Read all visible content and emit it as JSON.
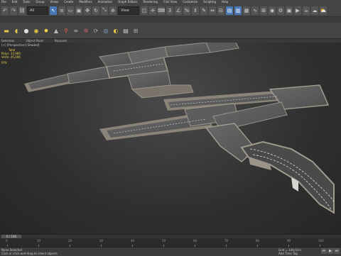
{
  "menu": [
    "File",
    "Edit",
    "Tools",
    "Group",
    "Views",
    "Create",
    "Modifiers",
    "Animation",
    "Graph Editors",
    "Rendering",
    "Civil View",
    "Customize",
    "Scripting",
    "Help"
  ],
  "toolbar": {
    "undo_icon": "↶",
    "redo_icon": "↷",
    "link_icon": "⛓",
    "filter_value": "All",
    "select_icon": "↖",
    "view_dropdown": "View",
    "render_icon": "▶"
  },
  "ribbon_icons": [
    "box-icon",
    "sphere-icon",
    "cylinder-icon",
    "light-icon",
    "camera-icon",
    "helper-icon",
    "space-warp-icon",
    "system-icon",
    "modifier-icon",
    "display-icon",
    "utility-icon",
    "shape-icon",
    "material-icon"
  ],
  "tabs": [
    "Selection",
    "Object Paint",
    "Populate"
  ],
  "viewport": {
    "label": "[+] [Perspective] [Shaded]",
    "stats_header": "Total",
    "polys_label": "Polys:",
    "polys_value": "32,960",
    "verts_label": "Verts:",
    "verts_value": "45,096",
    "fps_label": "FPS:"
  },
  "timeslider": {
    "label": "0 / 100"
  },
  "timeline": {
    "ticks": [
      "0",
      "10",
      "20",
      "30",
      "40",
      "50",
      "60",
      "70",
      "80",
      "90",
      "100"
    ]
  },
  "status": {
    "left": "None Selected",
    "hint": "Click or click-and-drag to select objects",
    "grid": "Grid = 100,0cm",
    "autokey": "Add Time Tag"
  }
}
